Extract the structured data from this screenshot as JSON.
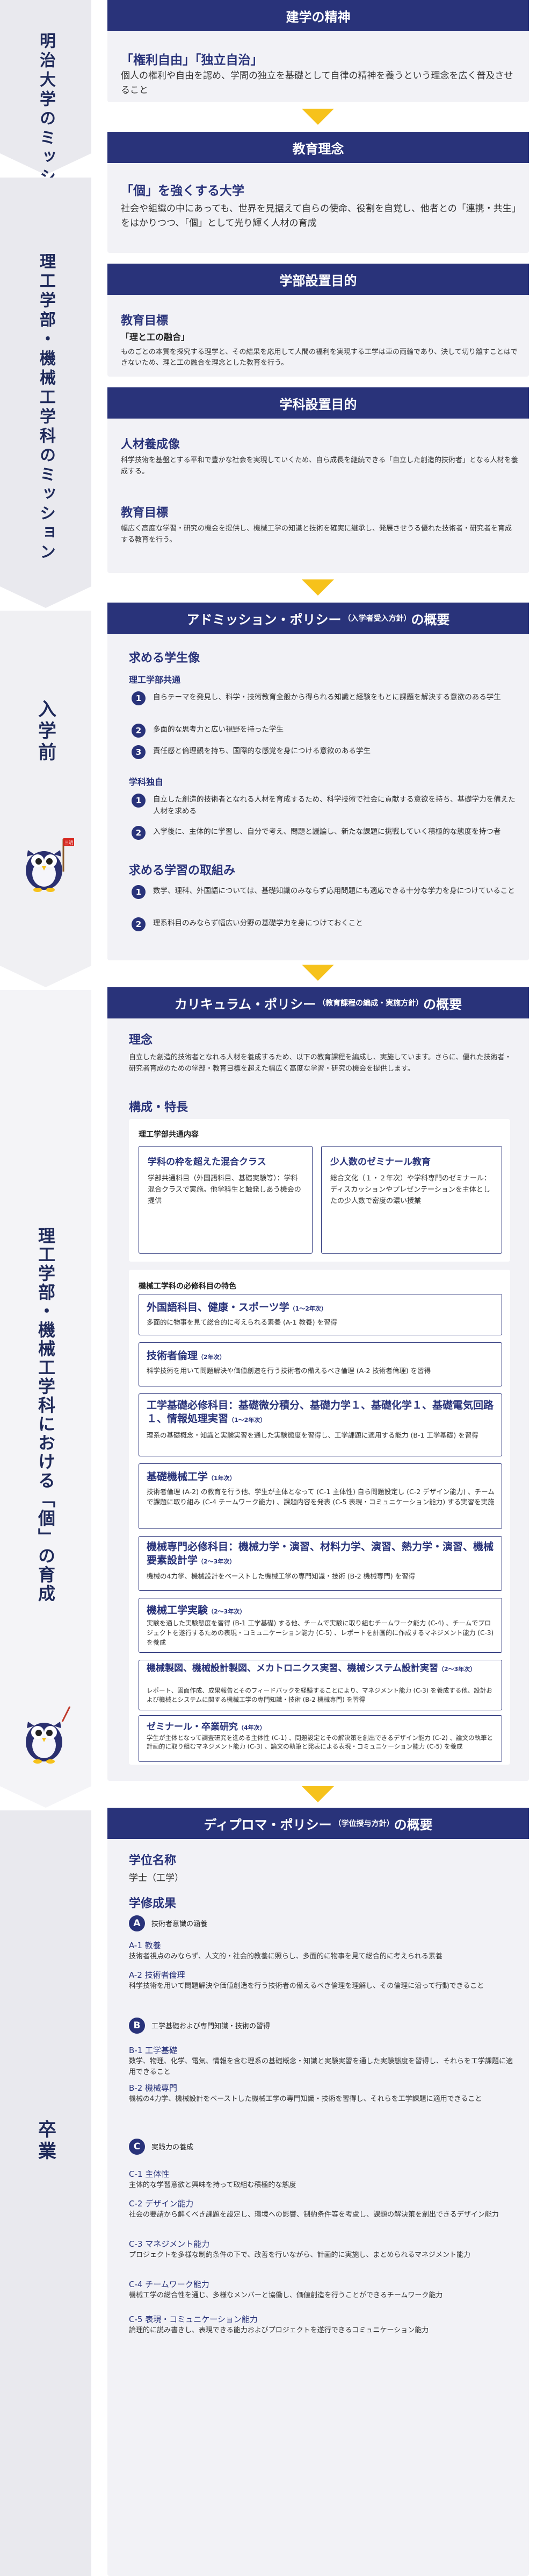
{
  "colors": {
    "navy": "#29337a",
    "yellow": "#f6c21b",
    "grey_band": "#e9e9ee",
    "card_bg": "#f2f2f6"
  },
  "left": {
    "mission_univ": "明治大学のミッション",
    "mission_dept": "理工学部・機械工学科のミッション",
    "admission": "入学前",
    "individual": "理工学部・機械工学科における「個」の育成",
    "graduation": "卒業"
  },
  "spirit": {
    "header": "建学の精神",
    "lead": "「権利自由」「独立自治」",
    "body": "個人の権利や自由を認め、学問の独立を基礎として自律の精神を養うという理念を広く普及させること"
  },
  "edu": {
    "header": "教育理念",
    "lead": "「個」を強くする大学",
    "body": "社会や組織の中にあっても、世界を見据えて自らの使命、役割を自覚し、他者との「連携・共生」をはかりつつ、「個」として光り輝く人材の育成"
  },
  "faculty": {
    "header": "学部設置目的",
    "goal_title": "教育目標",
    "goal_sub": "「理と工の融合」",
    "goal_body": "ものごとの本質を探究する理学と、その結果を応用して人間の福利を実現する工学は車の両輪であり、決して切り離すことはできないため、理と工の融合を理念とした教育を行う。"
  },
  "dept": {
    "header": "学科設置目的",
    "talent_title": "人材養成像",
    "talent_body": "科学技術を基盤とする平和で豊かな社会を実現していくため、自ら成長を継続できる「自立した創造的技術者」となる人材を養成する。",
    "goal_title": "教育目標",
    "goal_body": "幅広く高度な学習・研究の機会を提供し、機械工学の知識と技術を確実に継承し、発展させうる優れた技術者・研究者を育成する教育を行う。"
  },
  "ap": {
    "header": "アドミッション・ポリシー",
    "header_small": "（入学者受入方針）",
    "header_tail": "の概要",
    "seek_title": "求める学生像",
    "faculty_label": "理工学部共通",
    "faculty_items": [
      {
        "n": "1",
        "text": "自らテーマを発見し、科学・技術教育全般から得られる知識と経験をもとに課題を解決する意欲のある学生"
      },
      {
        "n": "2",
        "text": "多面的な思考力と広い視野を持った学生"
      },
      {
        "n": "3",
        "text": "責任感と倫理観を持ち、国際的な感覚を身につける意欲のある学生"
      }
    ],
    "dept_label": "学科独自",
    "dept_items": [
      {
        "n": "1",
        "text": "自立した創造的技術者となれる人材を育成するため、科学技術で社会に貢献する意欲を持ち、基礎学力を備えた人材を求める"
      },
      {
        "n": "2",
        "text": "入学後に、主体的に学習し、自分で考え、問題と議論し、新たな課題に挑戦していく積極的な態度を持つ者"
      }
    ],
    "prep_title": "求める学習の取組み",
    "prep_items": [
      {
        "n": "1",
        "text": "数学、理科、外国語については、基礎知識のみならず応用問題にも適応できる十分な学力を身につけていること"
      },
      {
        "n": "2",
        "text": "理系科目のみならず幅広い分野の基礎学力を身につけておくこと"
      }
    ]
  },
  "cp": {
    "header": "カリキュラム・ポリシー",
    "header_small": "（教育課程の編成・実施方針）",
    "header_tail": "の概要",
    "concept_title": "理念",
    "concept_body": "自立した創造的技術者となれる人材を養成するため、以下の教育課程を編成し、実施しています。さらに、優れた技術者・研究者育成のための学部・教育目標を超えた幅広く高度な学習・研究の機会を提供します。",
    "feature_title": "構成・特長",
    "common_label": "理工学部共通内容",
    "box1_title": "学科の枠を超えた混合クラス",
    "box1_body": "学部共通科目（外国語科目、基礎実験等）：学科混合クラスで実施。他学科生と触発しあう機会の提供",
    "box2_title": "少人数のゼミナール教育",
    "box2_body": "総合文化（１・２年次）や学科専門のゼミナール：ディスカッションやプレゼンテーションを主体としたの少人数で密度の濃い授業",
    "required_label": "機械工学科の必修科目の特色",
    "subjects": [
      {
        "title": "外国語科目、健康・スポーツ学",
        "years": "（1〜2年次）",
        "body": "多面的に物事を見て総合的に考えられる素養 (A-1 教養) を習得"
      },
      {
        "title": "技術者倫理",
        "years": "（2年次）",
        "body": "科学技術を用いて問題解決や価値創造を行う技術者の備えるべき倫理 (A-2 技術者倫理) を習得"
      },
      {
        "title": "工学基礎必修科目：基礎微分積分、基礎力学１、基礎化学１、基礎電気回路１、情報処理実習",
        "years": "（1〜2年次）",
        "body": "理系の基礎概念・知識と実験実習を通した実験態度を習得し、工学課題に適用する能力 (B-1 工学基礎) を習得"
      },
      {
        "title": "基礎機械工学",
        "years": "（1年次）",
        "body": "技術者倫理 (A-2) の教育を行う他、学生が主体となって (C-1 主体性) 自ら問題設定し (C-2 デザイン能力) 、チームで課題に取り組み (C-4 チームワーク能力) 、課題内容を発表 (C-5 表現・コミュニケーション能力) する実習を実施"
      },
      {
        "title": "機械専門必修科目：機械力学・演習、材料力学、演習、熱力学・演習、機械要素設計学",
        "years": "（2〜3年次）",
        "body": "機械の4力学、機械設計をベーストした機械工学の専門知識・技術 (B-2 機械専門) を習得"
      },
      {
        "title": "機械工学実験",
        "years": "（2〜3年次）",
        "body": "実験を通した実験態度を習得 (B-1 工学基礎) する他、チームで実験に取り組むチームワーク能力 (C-4) 、チームでプロジェクトを遂行するための表現・コミュニケーション能力 (C-5) 、レポートを計画的に作成するマネジメント能力 (C-3) を養成"
      },
      {
        "title": "機械製図、機械設計製図、メカトロニクス実習、機械システム設計実習",
        "years": "（2〜3年次）",
        "body": "レポート、図面作成、成果報告とそのフィードバックを経験することにより、マネジメント能力 (C-3) を養成する他、設計および機械とシステムに関する機械工学の専門知識・技術 (B-2 機械専門) を習得"
      },
      {
        "title": "ゼミナール・卒業研究",
        "years": "（4年次）",
        "body": "学生が主体となって調査研究を進める主体性 (C-1) 、問題設定とその解決策を創出できるデザイン能力 (C-2) 、論文の執筆と計画的に取り組むマネジメント能力 (C-3) 、論文の執筆と発表による表現・コミュニケーション能力 (C-5) を養成"
      }
    ]
  },
  "dp": {
    "header": "ディプロマ・ポリシー",
    "header_small": "（学位授与方針）",
    "header_tail": "の概要",
    "degree_title": "学位名称",
    "degree_value": "学士（工学）",
    "results_title": "学修成果",
    "A_label": "技術者意識の涵養",
    "A_items": [
      {
        "code": "A-1 教養",
        "text": "技術者視点のみならず、人文的・社会的教養に照らし、多面的に物事を見て総合的に考えられる素養"
      },
      {
        "code": "A-2 技術者倫理",
        "text": "科学技術を用いて問題解決や価値創造を行う技術者の備えるべき倫理を理解し、その倫理に沿って行動できること"
      }
    ],
    "B_label": "工学基礎および専門知識・技術の習得",
    "B_items": [
      {
        "code": "B-1 工学基礎",
        "text": "数学、物理、化学、電気、情報を含む理系の基礎概念・知識と実験実習を通した実験態度を習得し、それらを工学課題に適用できること"
      },
      {
        "code": "B-2 機械専門",
        "text": "機械の4力学、機械設計をベーストした機械工学の専門知識・技術を習得し、それらを工学課題に適用できること"
      }
    ],
    "C_label": "実践力の養成",
    "C_items": [
      {
        "code": "C-1 主体性",
        "text": "主体的な学習意欲と興味を持って取組む積極的な態度"
      },
      {
        "code": "C-2 デザイン能力",
        "text": "社会の要請から解くべき課題を設定し、環境への影響、制約条件等を考慮し、課題の解決策を創出できるデザイン能力"
      },
      {
        "code": "C-3 マネジメント能力",
        "text": "プロジェクトを多様な制約条件の下で、改善を行いながら、計画的に実施し、まとめられるマネジメント能力"
      },
      {
        "code": "C-4 チームワーク能力",
        "text": "機械工学の総合性を通じ、多様なメンバーと協働し、価値創造を行うことができるチームワーク能力"
      },
      {
        "code": "C-5 表現・コミュニケーション能力",
        "text": "論理的に説み書きし、表現できる能力およびプロジェクトを遂行できるコミュニケーション能力"
      }
    ],
    "letters": [
      "A",
      "B",
      "C"
    ]
  },
  "icons": {
    "arrow": "down-chevron-arrow",
    "mascot": "owl-mascot"
  },
  "mascot_flag": "三明"
}
